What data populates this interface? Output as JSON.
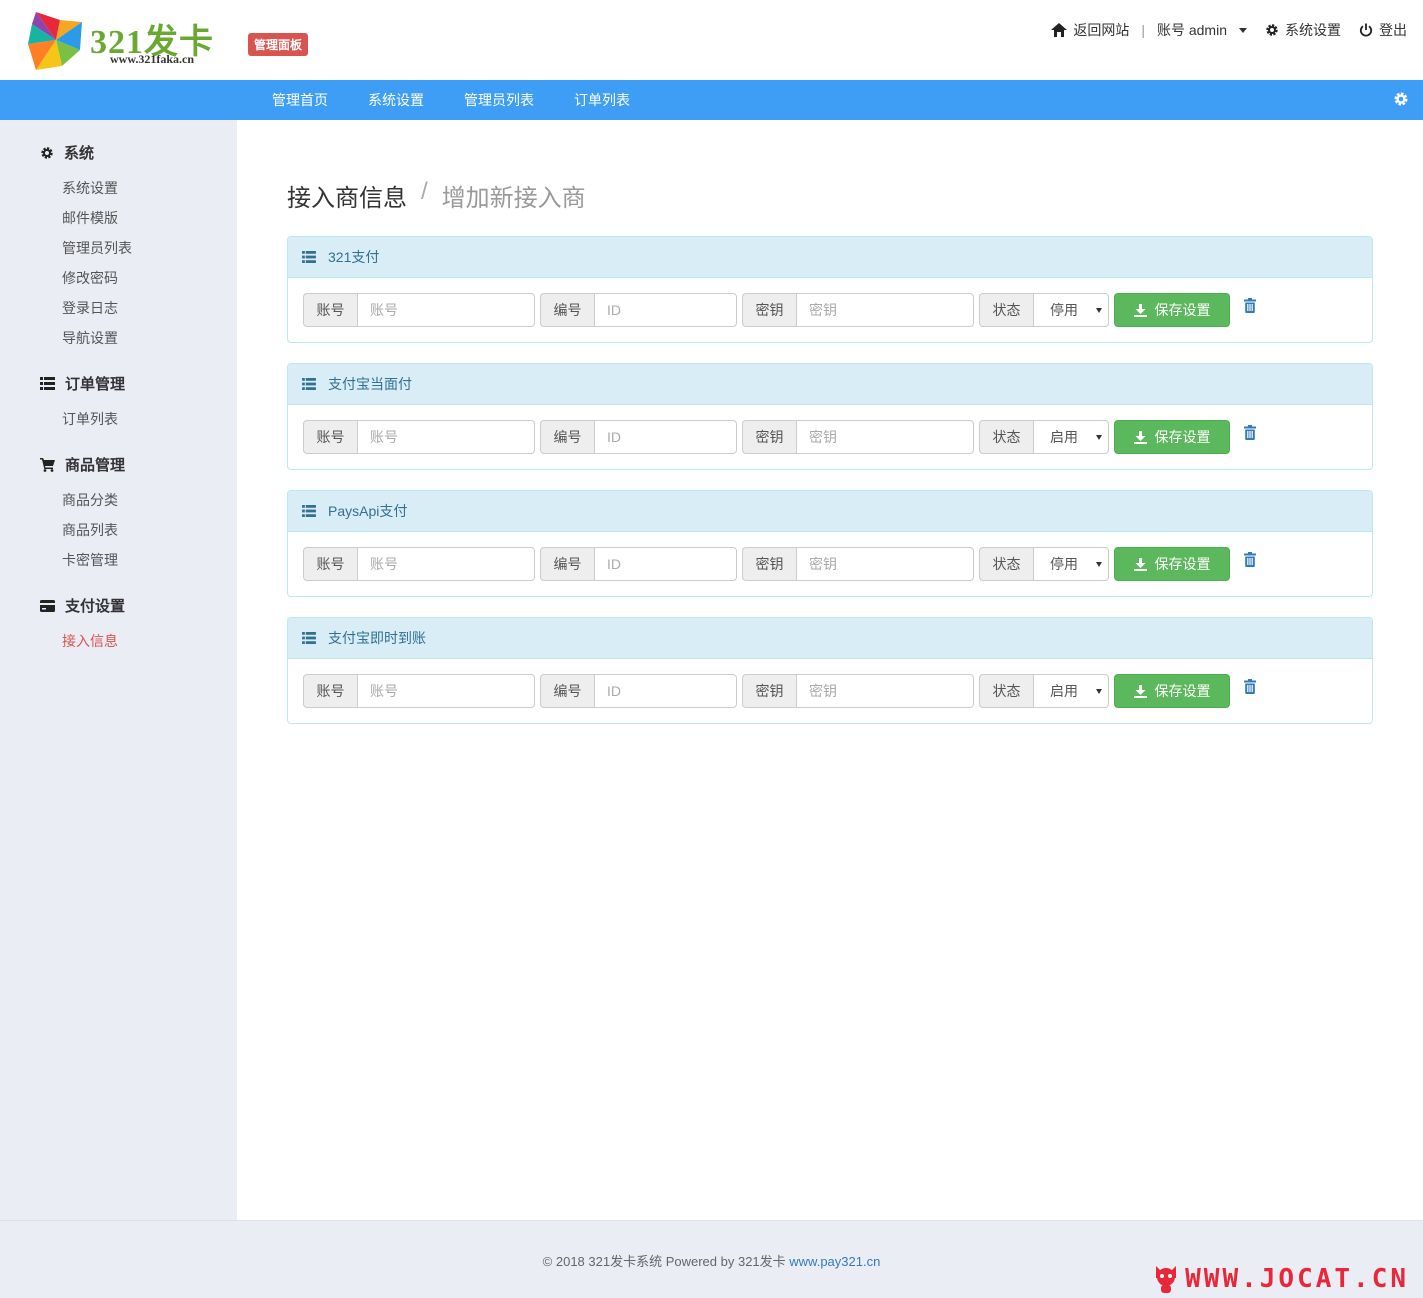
{
  "header": {
    "logo_text": "321发卡",
    "logo_sub": "www.321faka.cn",
    "badge": "管理面板",
    "nav": {
      "home": "返回网站",
      "account": "账号 admin",
      "settings": "系统设置",
      "logout": "登出"
    }
  },
  "menubar": [
    "管理首页",
    "系统设置",
    "管理员列表",
    "订单列表"
  ],
  "sidebar": {
    "sections": [
      {
        "title": "系统",
        "items": [
          "系统设置",
          "邮件模版",
          "管理员列表",
          "修改密码",
          "登录日志",
          "导航设置"
        ]
      },
      {
        "title": "订单管理",
        "items": [
          "订单列表"
        ]
      },
      {
        "title": "商品管理",
        "items": [
          "商品分类",
          "商品列表",
          "卡密管理"
        ]
      },
      {
        "title": "支付设置",
        "items": [
          "接入信息"
        ]
      }
    ]
  },
  "page": {
    "title": "接入商信息",
    "separator": "/",
    "subtitle": "增加新接入商"
  },
  "form_labels": {
    "account": "账号",
    "account_placeholder": "账号",
    "id": "编号",
    "id_placeholder": "ID",
    "key": "密钥",
    "key_placeholder": "密钥",
    "status": "状态",
    "save": "保存设置"
  },
  "providers": [
    {
      "name": "321支付",
      "status": "停用"
    },
    {
      "name": "支付宝当面付",
      "status": "启用"
    },
    {
      "name": "PaysApi支付",
      "status": "停用"
    },
    {
      "name": "支付宝即时到账",
      "status": "启用"
    }
  ],
  "footer": {
    "text": "© 2018  321发卡系统 Powered by 321发卡 ",
    "link": "www.pay321.cn"
  },
  "watermark": "WWW.JOCAT.CN",
  "colors": {
    "accent_blue": "#3e9ef6",
    "badge_red": "#d9534f",
    "save_green": "#5cb85c",
    "panel_head": "#d9edf7",
    "sidebar_bg": "#eaedf3"
  }
}
